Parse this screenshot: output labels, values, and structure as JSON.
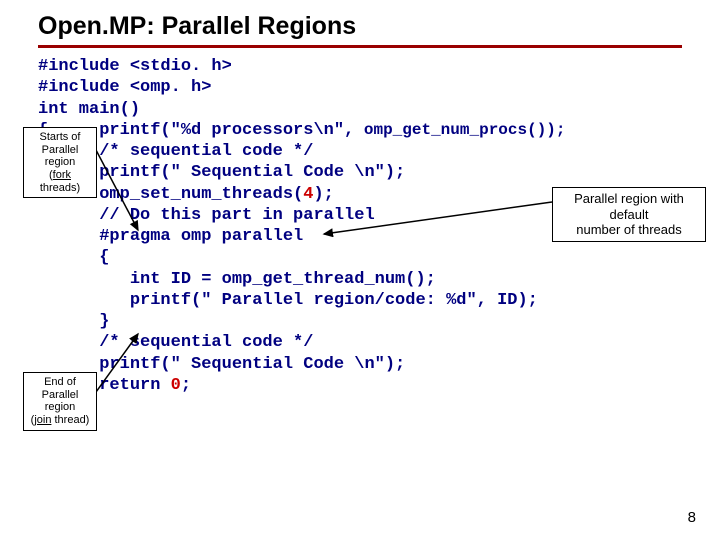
{
  "title": "Open.MP: Parallel Regions",
  "code": {
    "l1": "#include <stdio. h>",
    "l2": "#include <omp. h>",
    "l3": "int main()",
    "l4": "{     printf(\"%d processors\\n\",",
    "l4b": " omp_get_num_procs());",
    "l5": "      /* sequential code */",
    "l6": "      printf(\" Sequential Code \\n\");",
    "l7": "      omp_set_num_threads(",
    "l7b": "4",
    "l7c": ");",
    "l8": "      // Do this part in parallel",
    "l9": "      #pragma omp parallel",
    "l10": "      {",
    "l11": "         int ID = omp_get_thread_num();",
    "l12": "         printf(\" Parallel region/code: %d\", ID);",
    "l13": "      }",
    "l14": "      /* sequential code */",
    "l15": "      printf(\" Sequential Code \\n\");",
    "l16": "      return ",
    "l16b": "0",
    "l16c": ";",
    "l17": "}"
  },
  "label_start_l1": "Starts of",
  "label_start_l2": "Parallel region",
  "label_start_l3": "(fork threads)",
  "label_end_l1": "End of",
  "label_end_l2": "Parallel region",
  "label_end_l3": "(join thread)",
  "label_right_l1": "Parallel region with default",
  "label_right_l2": "number of threads",
  "pagenum": "8"
}
